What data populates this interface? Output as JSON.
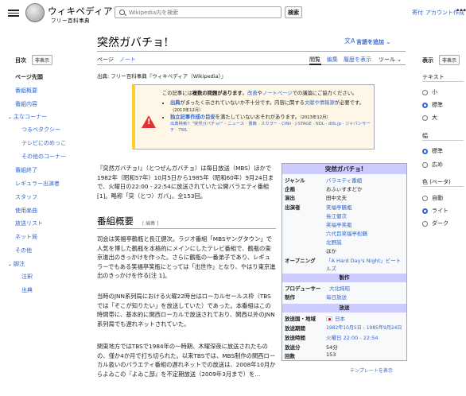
{
  "header": {
    "wordmark": "ウィキペディア",
    "tagline": "フリー百科事典",
    "search_placeholder": "Wikipedia内を検索",
    "search_button": "検索",
    "donate": "寄付",
    "create_account": "アカウント作成",
    "more": "•••"
  },
  "toc": {
    "title": "目次",
    "hide": "非表示",
    "items": [
      {
        "label": "ページ先頭"
      },
      {
        "label": "番組概要"
      },
      {
        "label": "番組内容"
      },
      {
        "label": "主なコーナー"
      },
      {
        "label": "つるベタクシー"
      },
      {
        "label": "テレビにのめっこ"
      },
      {
        "label": "その他のコーナー"
      },
      {
        "label": "番組終了"
      },
      {
        "label": "レギュラー出演者"
      },
      {
        "label": "スタッフ"
      },
      {
        "label": "使用楽曲"
      },
      {
        "label": "放送リスト"
      },
      {
        "label": "ネット局"
      },
      {
        "label": "その他"
      },
      {
        "label": "脚注"
      },
      {
        "label": "注釈"
      },
      {
        "label": "出典"
      }
    ]
  },
  "page": {
    "title": "突然ガバチョ!",
    "language_button": "言語を追加",
    "tabs": {
      "article": "ページ",
      "talk": "ノート",
      "read": "閲覧",
      "edit": "編集",
      "history": "履歴を表示",
      "tools": "ツール"
    },
    "source": "出典: フリー百科事典『ウィキペディア（Wikipedia）』"
  },
  "notice": {
    "intro_a": "この記事には",
    "intro_b": "複数の問題があります",
    "intro_c": "。",
    "intro_d": "改善",
    "intro_e": "や",
    "intro_f": "ノートページ",
    "intro_g": "での議論にご協力ください。",
    "item1_a": "出典",
    "item1_b": "がまったく示されていないか不十分です。内容に関する",
    "item1_c": "文献や情報源",
    "item1_d": "が必要です。",
    "item1_date": "（2013年12月）",
    "item2_a": "独立記事作成の目安",
    "item2_b": "を満たしていないおそれがあります。",
    "item2_date": "（2013年12月）",
    "search_hint": "出典検索?: \"突然ガバチョ!\" – ニュース · 書籍 · スカラー · CiNii · J-STAGE · NDL · dlib.jp · ジャパンサーチ · TWL"
  },
  "article": {
    "lead": "『突然ガバチョ!』（とつぜんガバチョ）は毎日放送（MBS）ほかで1982年（昭和57年）10月5日から1985年（昭和60年）9月24日まで、火曜日の22:00 - 22:54に放送されていた公開バラエティ番組[1]。略称「突（とつ）ガバ」。全153回。",
    "overview_heading": "番組概要",
    "overview_edit": "[ 編集 ]",
    "para1": "司会は笑福亭鶴瓶と長江健次。ラジオ番組「MBSヤングタウン」で人気を博した鶴瓶を本格的にメインにしたテレビ番組で、鶴瓶の東京進出のきっかけを作った。さらに鶴瓶の一番弟子であり、レギュラーでもある笑福亭笑瓶にとっては「出世作」となり、やはり東京進出のきっかけを作る[注 1]。",
    "para2": "当時のJNN系列局における火曜22時台はローカルセールス枠（TBSでは「そこが知りたい」を放送していた）であった。本番組はこの時間帯に、基本的に関西ローカルで放送されており、関西以外のJNN系列局でも遅れネットされていた。",
    "para3": "関東地方ではTBSで1984年の一時期、木曜深夜に放送されたものの、僅か4か月で打ち切られた。以来TBSでは、MBS制作の関西ローカル扱いのバラエティ番組の遅れネットでの放送は、2008年10月からよゐこの『よゐこ部』を不定期放送（2009年3月まで）を..."
  },
  "infobox": {
    "title": "突然ガバチョ!",
    "rows": [
      {
        "k": "ジャンル",
        "v": "バラエティ番組"
      },
      {
        "k": "企画",
        "v": "おふぃすまどか"
      },
      {
        "k": "演出",
        "v": "田中文夫"
      },
      {
        "k": "出演者",
        "v": "笑福亭鶴瓶"
      },
      {
        "k": "",
        "v": "長江健次"
      },
      {
        "k": "",
        "v": "笑福亭笑瓶"
      },
      {
        "k": "",
        "v": "六代目笑福亭松鶴"
      },
      {
        "k": "",
        "v": "北野誠"
      },
      {
        "k": "",
        "v": "ほか"
      },
      {
        "k": "オープニング",
        "v": "「A Hard Day's Night」ビートルズ"
      }
    ],
    "production_band": "製作",
    "producer_k": "プロデューサー",
    "producer_v": "大北純昭",
    "maker_k": "制作",
    "maker_v": "毎日放送",
    "broadcast_band": "放送",
    "region_k": "放送国・地域",
    "region_v": "日本",
    "period_k": "放送期間",
    "period_v": "1982年10月5日 - 1985年9月24日",
    "slot_k": "放送時間",
    "slot_v": "火曜日 22:00 - 22:54",
    "length_k": "放送分",
    "length_v": "54分",
    "count_k": "回数",
    "count_v": "153",
    "template": "テンプレートを表示"
  },
  "display": {
    "title": "表示",
    "hide": "非表示",
    "text_label": "テキスト",
    "text_opts": [
      "小",
      "標準",
      "大"
    ],
    "text_selected": 1,
    "width_label": "幅",
    "width_opts": [
      "標準",
      "広め"
    ],
    "width_selected": 0,
    "color_label": "色 (ベータ)",
    "color_opts": [
      "自動",
      "ライト",
      "ダーク"
    ],
    "color_selected": 1
  }
}
